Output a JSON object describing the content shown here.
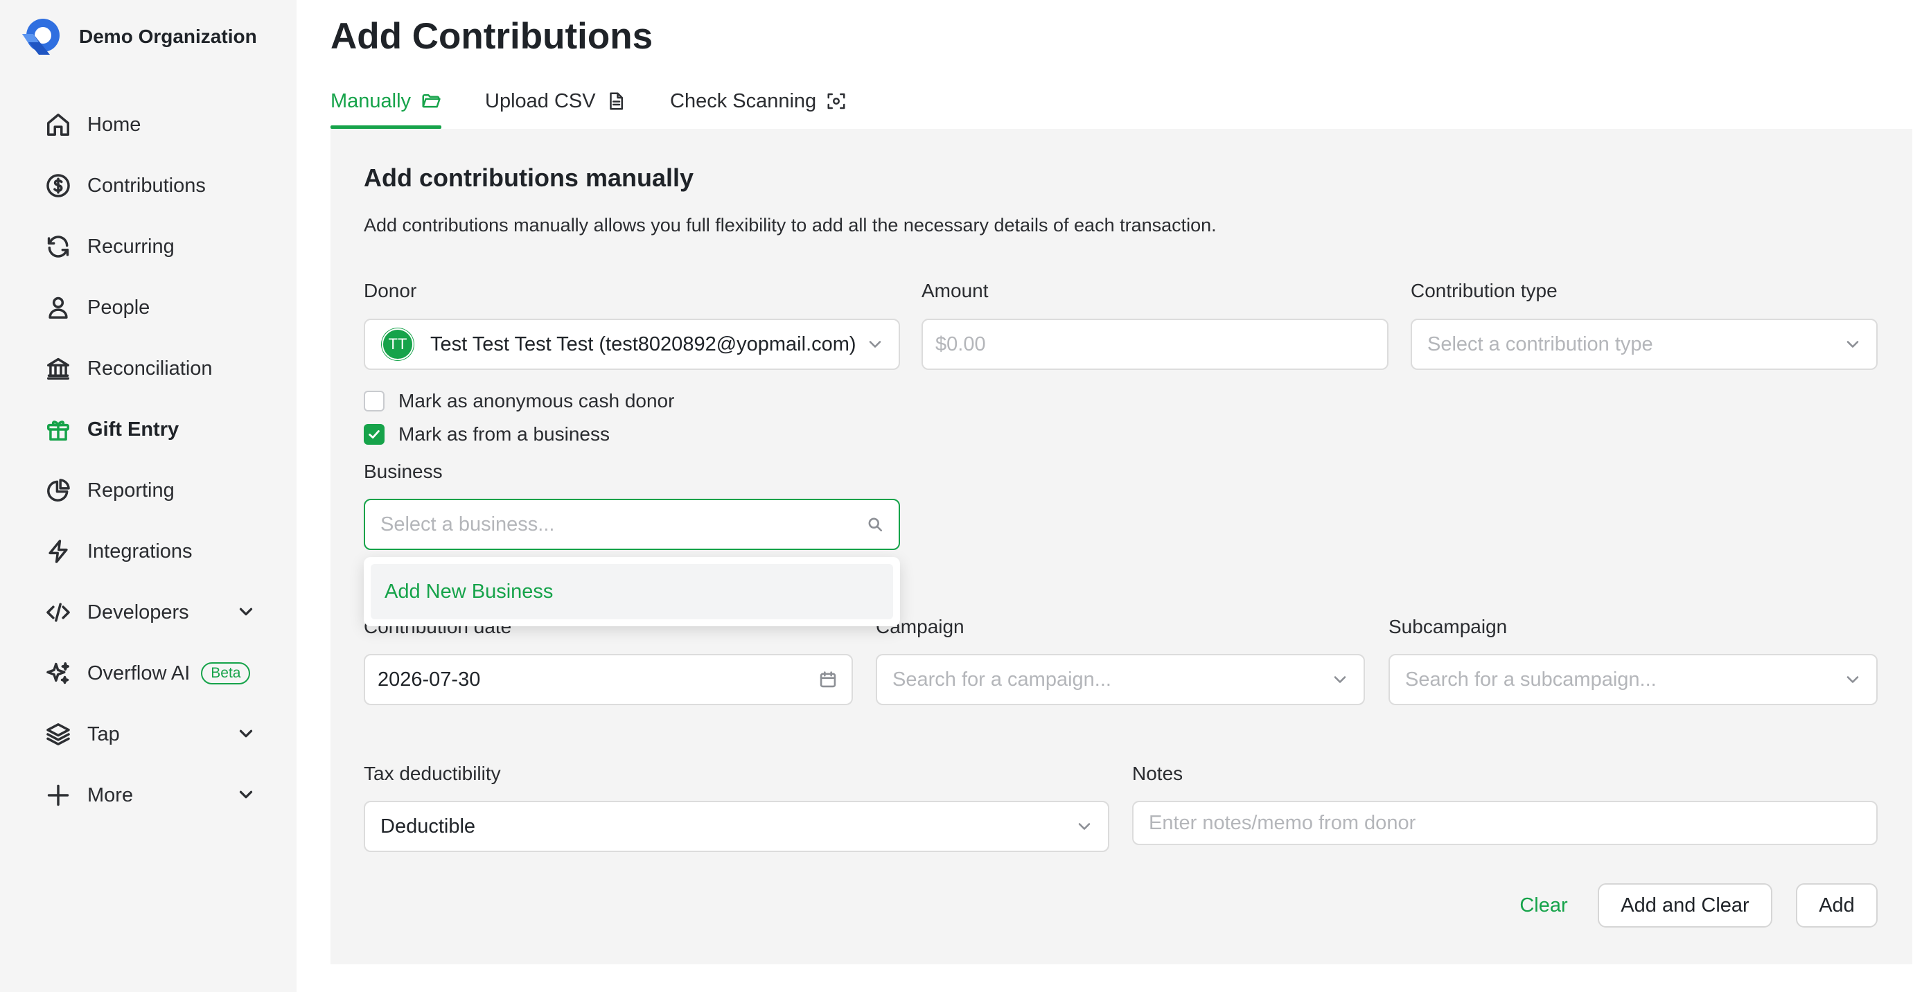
{
  "org": {
    "name": "Demo Organization"
  },
  "nav": {
    "home": "Home",
    "contributions": "Contributions",
    "recurring": "Recurring",
    "people": "People",
    "reconciliation": "Reconciliation",
    "gift_entry": "Gift Entry",
    "reporting": "Reporting",
    "integrations": "Integrations",
    "developers": "Developers",
    "overflow_ai": "Overflow AI",
    "overflow_ai_badge": "Beta",
    "tap": "Tap",
    "more": "More",
    "active": "Gift Entry"
  },
  "page": {
    "title": "Add Contributions"
  },
  "tabs": [
    {
      "label": "Manually",
      "icon": "folder-icon",
      "active": true
    },
    {
      "label": "Upload CSV",
      "icon": "file-icon",
      "active": false
    },
    {
      "label": "Check Scanning",
      "icon": "scan-icon",
      "active": false
    }
  ],
  "form": {
    "heading": "Add contributions manually",
    "description": "Add contributions manually allows you full flexibility to add all the necessary details of each transaction.",
    "donor": {
      "label": "Donor",
      "initials": "TT",
      "value": "Test Test Test Test (test8020892@yopmail.com)"
    },
    "amount": {
      "label": "Amount",
      "placeholder": "$0.00"
    },
    "contribution_type": {
      "label": "Contribution type",
      "placeholder": "Select a contribution type"
    },
    "anonymous": {
      "label": "Mark as anonymous cash donor",
      "checked": false
    },
    "business_flag": {
      "label": "Mark as from a business",
      "checked": true
    },
    "business": {
      "label": "Business",
      "placeholder": "Select a business...",
      "dropdown_option": "Add New Business"
    },
    "contribution_date": {
      "label": "Contribution date",
      "value": "2026-07-30"
    },
    "campaign": {
      "label": "Campaign",
      "placeholder": "Search for a campaign..."
    },
    "subcampaign": {
      "label": "Subcampaign",
      "placeholder": "Search for a subcampaign..."
    },
    "tax": {
      "label": "Tax deductibility",
      "value": "Deductible"
    },
    "notes": {
      "label": "Notes",
      "placeholder": "Enter notes/memo from donor"
    }
  },
  "actions": {
    "clear": "Clear",
    "add_and_clear": "Add and Clear",
    "add": "Add"
  },
  "colors": {
    "accent": "#16a34a",
    "sidebar_bg": "#f5f5f5",
    "panel_bg": "#f4f4f4"
  }
}
